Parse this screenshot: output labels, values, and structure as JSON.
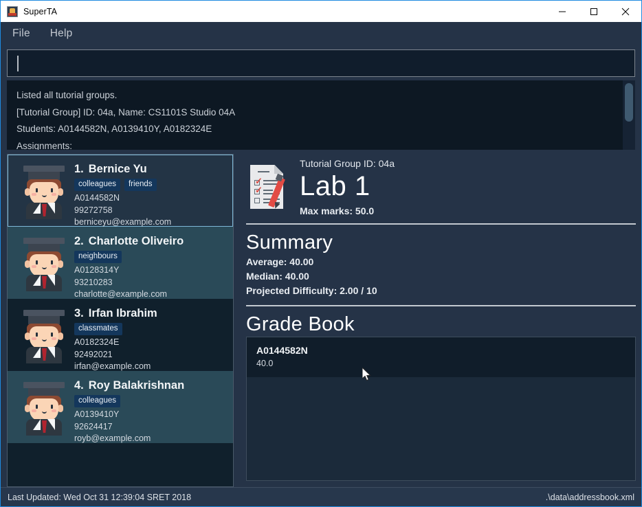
{
  "window": {
    "title": "SuperTA",
    "app_icon": "app-icon",
    "controls": {
      "minimize": "minimize-icon",
      "maximize": "maximize-icon",
      "close": "close-icon"
    }
  },
  "menubar": {
    "items": [
      {
        "label": "File"
      },
      {
        "label": "Help"
      }
    ]
  },
  "command_box": {
    "value": "",
    "placeholder": ""
  },
  "result_display": {
    "lines": [
      "Listed all tutorial groups.",
      "[Tutorial Group] ID: 04a, Name: CS1101S Studio 04A",
      "Students: A0144582N, A0139410Y, A0182324E",
      "Assignments:"
    ]
  },
  "person_list": {
    "cards": [
      {
        "index": "1.",
        "name": "Bernice Yu",
        "tags": [
          "colleagues",
          "friends"
        ],
        "student_id": "A0144582N",
        "phone": "99272758",
        "email": "berniceyu@example.com",
        "selected": true
      },
      {
        "index": "2.",
        "name": "Charlotte Oliveiro",
        "tags": [
          "neighbours"
        ],
        "student_id": "A0128314Y",
        "phone": "93210283",
        "email": "charlotte@example.com",
        "selected": false
      },
      {
        "index": "3.",
        "name": "Irfan Ibrahim",
        "tags": [
          "classmates"
        ],
        "student_id": "A0182324E",
        "phone": "92492021",
        "email": "irfan@example.com",
        "selected": false
      },
      {
        "index": "4.",
        "name": "Roy Balakrishnan",
        "tags": [
          "colleagues"
        ],
        "student_id": "A0139410Y",
        "phone": "92624417",
        "email": "royb@example.com",
        "selected": false
      }
    ]
  },
  "detail": {
    "icon": "clipboard-checklist-icon",
    "tutorial_group_id": "Tutorial Group ID: 04a",
    "assignment_name": "Lab 1",
    "max_marks": "Max marks: 50.0",
    "summary": {
      "title": "Summary",
      "average": "Average: 40.00",
      "median": "Median: 40.00",
      "difficulty": "Projected Difficulty: 2.00 / 10"
    },
    "gradebook": {
      "title": "Grade Book",
      "entries": [
        {
          "student_id": "A0144582N",
          "mark": "40.0"
        }
      ]
    }
  },
  "statusbar": {
    "last_updated": "Last Updated: Wed Oct 31 12:39:04 SRET 2018",
    "file_path": ".\\data\\addressbook.xml"
  },
  "colors": {
    "accent": "#1e8ae0",
    "panel_bg": "#253347",
    "list_row_alt": "#2a4a58",
    "list_row": "#10202c",
    "selection_border": "#7fb8d8",
    "tag_bg": "#14375c"
  }
}
